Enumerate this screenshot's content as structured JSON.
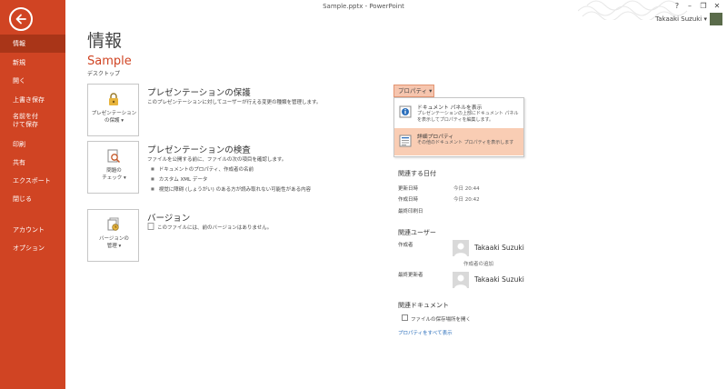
{
  "window": {
    "title": "Sample.pptx - PowerPoint",
    "help": "?",
    "minimize": "–",
    "restore": "❐",
    "close": "✕"
  },
  "user": {
    "name": "Takaaki Suzuki ▾"
  },
  "sidebar": {
    "items": [
      {
        "label": "情報"
      },
      {
        "label": "新規"
      },
      {
        "label": "開く"
      },
      {
        "label": "上書き保存"
      },
      {
        "label": "名前を付けて保存"
      },
      {
        "label": "印刷"
      },
      {
        "label": "共有"
      },
      {
        "label": "エクスポート"
      },
      {
        "label": "閉じる"
      },
      {
        "label": "アカウント"
      },
      {
        "label": "オプション"
      }
    ]
  },
  "main": {
    "page_title": "情報",
    "doc_name": "Sample",
    "doc_location": "デスクトップ",
    "sections": [
      {
        "button_label_1": "プレゼンテーション",
        "button_label_2": "の保護 ▾",
        "title": "プレゼンテーションの保護",
        "desc": "このプレゼンテーションに対してユーザーが行える変更の種類を管理します。",
        "icon": "lock-icon"
      },
      {
        "button_label_1": "問題の",
        "button_label_2": "チェック ▾",
        "title": "プレゼンテーションの検査",
        "desc": "ファイルを公開する前に、ファイルの次の項目を確認します。",
        "bullets": [
          "ドキュメントのプロパティ、作成者の名前",
          "カスタム XML データ",
          "視覚に障碍 (しょうがい) のある方が読み取れない可能性がある内容"
        ],
        "icon": "inspect-icon"
      },
      {
        "button_label_1": "バージョンの",
        "button_label_2": "管理 ▾",
        "title": "バージョン",
        "desc": "このファイルには、前のバージョンはありません。",
        "icon": "versions-icon"
      }
    ]
  },
  "properties": {
    "button": "プロパティ ▾",
    "menu": [
      {
        "title": "ドキュメント パネルを表示",
        "desc": "プレゼンテーションの上部にドキュメント パネルを表示してプロパティを編集します。"
      },
      {
        "title": "詳細プロパティ",
        "desc": "その他のドキュメント プロパティを表示します"
      }
    ],
    "dates_heading": "関連する日付",
    "dates": [
      {
        "label": "更新日時",
        "value": "今日 20:44"
      },
      {
        "label": "作成日時",
        "value": "今日 20:42"
      },
      {
        "label": "最終印刷日",
        "value": ""
      }
    ],
    "people_heading": "関連ユーザー",
    "author_label": "作成者",
    "author_name": "Takaaki Suzuki",
    "add_author": "作成者の追加",
    "last_modified_label": "最終更新者",
    "last_modified_name": "Takaaki Suzuki",
    "docs_heading": "関連ドキュメント",
    "open_location": "ファイルの保存場所を開く",
    "show_all": "プロパティをすべて表示"
  },
  "colors": {
    "sidebar": "#d04423",
    "sidebar_active": "#a93518",
    "accent": "#d04423",
    "highlight": "#f9cdb4",
    "link": "#2a6ebb"
  }
}
